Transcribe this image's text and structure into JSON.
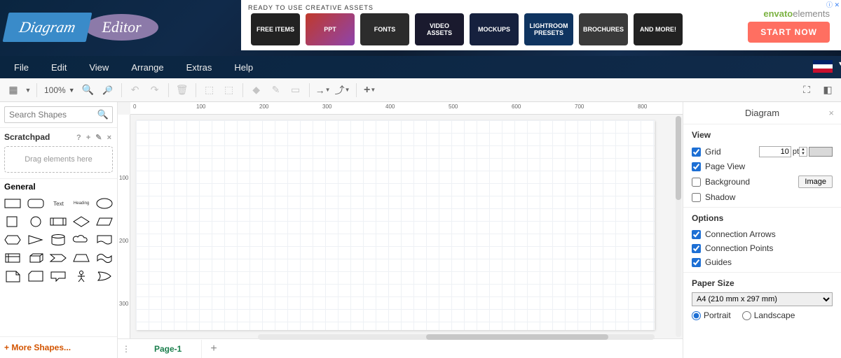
{
  "logo": {
    "left": "Diagram",
    "right": "Editor"
  },
  "ad": {
    "heading": "READY TO USE CREATIVE ASSETS",
    "items": [
      "FREE ITEMS",
      "PPT",
      "FONTS",
      "VIDEO ASSETS",
      "MOCKUPS",
      "LIGHTROOM PRESETS",
      "BROCHURES",
      "AND MORE!"
    ],
    "brand_a": "envato",
    "brand_b": "elements",
    "cta": "START NOW",
    "close_hint": "ⓘ ✕"
  },
  "menubar": [
    "File",
    "Edit",
    "View",
    "Arrange",
    "Extras",
    "Help"
  ],
  "toolbar": {
    "zoom_value": "100%"
  },
  "left": {
    "search_placeholder": "Search Shapes",
    "scratchpad_label": "Scratchpad",
    "scratchpad_tools": "? + ✎ ×",
    "drop_hint": "Drag elements here",
    "general_label": "General",
    "text_shape_label": "Text",
    "heading_shape_label": "Heading",
    "more_shapes": "More Shapes..."
  },
  "ruler_h": [
    "0",
    "100",
    "200",
    "300",
    "400",
    "500",
    "600",
    "700",
    "800"
  ],
  "ruler_v": [
    "100",
    "200",
    "300"
  ],
  "tabs": {
    "page1": "Page-1"
  },
  "right": {
    "title": "Diagram",
    "view": {
      "heading": "View",
      "grid": "Grid",
      "grid_size": "10",
      "grid_unit": "pt",
      "page_view": "Page View",
      "background": "Background",
      "image_btn": "Image",
      "shadow": "Shadow"
    },
    "options": {
      "heading": "Options",
      "conn_arrows": "Connection Arrows",
      "conn_points": "Connection Points",
      "guides": "Guides"
    },
    "paper": {
      "heading": "Paper Size",
      "value": "A4 (210 mm x 297 mm)",
      "portrait": "Portrait",
      "landscape": "Landscape"
    }
  }
}
